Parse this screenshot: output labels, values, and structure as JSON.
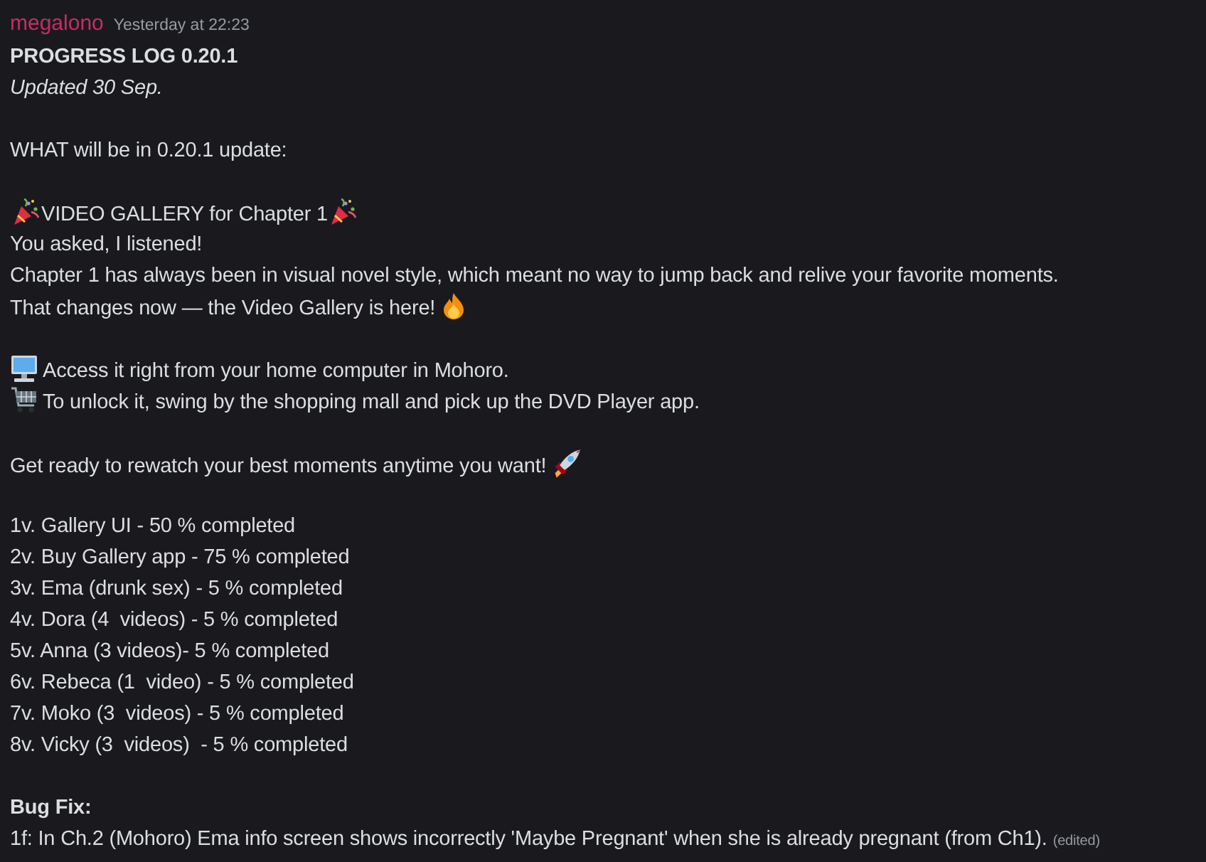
{
  "message": {
    "author": "megalono",
    "timestamp": "Yesterday at 22:23",
    "lines": [
      {
        "kind": "bold",
        "text": "PROGRESS LOG 0.20.1"
      },
      {
        "kind": "italic",
        "text": "Updated 30 Sep."
      },
      {
        "kind": "gap"
      },
      {
        "kind": "plain",
        "text": "WHAT will be in 0.20.1 update:"
      },
      {
        "kind": "gap"
      },
      {
        "kind": "party",
        "text": "VIDEO GALLERY for Chapter 1"
      },
      {
        "kind": "plain",
        "text": "You asked, I listened!"
      },
      {
        "kind": "plain",
        "text": "Chapter 1 has always been in visual novel style, which meant no way to jump back and relive your favorite moments."
      },
      {
        "kind": "fire",
        "text": "That changes now — the Video Gallery is here!"
      },
      {
        "kind": "gap"
      },
      {
        "kind": "computer",
        "text": "Access it right from your home computer in Mohoro."
      },
      {
        "kind": "cart",
        "text": "To unlock it, swing by the shopping mall and pick up the DVD Player app."
      },
      {
        "kind": "gap"
      },
      {
        "kind": "rocket",
        "text": "Get ready to rewatch your best moments anytime you want!"
      },
      {
        "kind": "gap"
      },
      {
        "kind": "plain",
        "text": "1v. Gallery UI - 50 % completed"
      },
      {
        "kind": "plain",
        "text": "2v. Buy Gallery app - 75 % completed"
      },
      {
        "kind": "plain",
        "text": "3v. Ema (drunk sex) - 5 % completed"
      },
      {
        "kind": "plain",
        "text": "4v. Dora (4  videos) - 5 % completed"
      },
      {
        "kind": "plain",
        "text": "5v. Anna (3 videos)- 5 % completed"
      },
      {
        "kind": "plain",
        "text": "6v. Rebeca (1  video) - 5 % completed"
      },
      {
        "kind": "plain",
        "text": "7v. Moko (3  videos) - 5 % completed"
      },
      {
        "kind": "plain",
        "text": "8v. Vicky (3  videos)  - 5 % completed"
      },
      {
        "kind": "gap"
      },
      {
        "kind": "bold",
        "text": "Bug Fix:"
      },
      {
        "kind": "plain",
        "text": "1f: In Ch.2 (Mohoro) Ema info screen shows incorrectly 'Maybe Pregnant' when she is already pregnant (from Ch1).",
        "note": "(edited)"
      }
    ]
  }
}
